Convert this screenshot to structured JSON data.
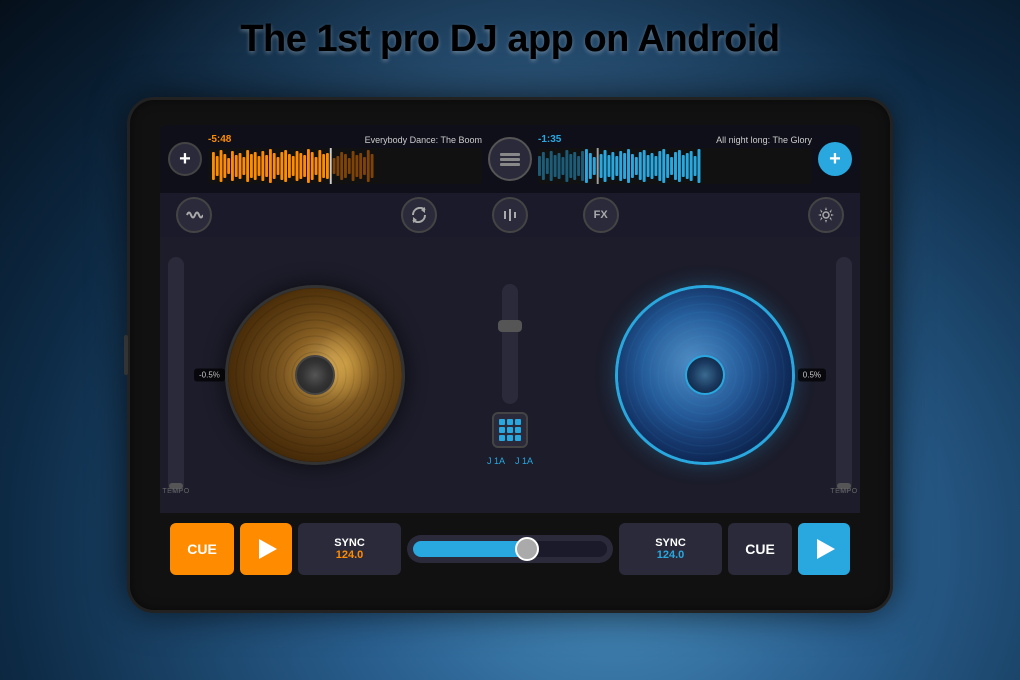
{
  "page": {
    "title": "The 1st pro DJ app on Android"
  },
  "app": {
    "track_left": {
      "time": "-5:48",
      "name": "Everybody Dance: The Boom"
    },
    "track_right": {
      "time": "-1:35",
      "name": "All night long: The Glory"
    },
    "deck_left": {
      "pitch": "-0.5%",
      "sync_label": "SYNC",
      "sync_bpm": "124.0",
      "cue_label": "CUE",
      "tempo_label": "TEMPO"
    },
    "deck_right": {
      "pitch": "0.5%",
      "sync_label": "SYNC",
      "sync_bpm": "124.0",
      "cue_label": "CUE",
      "tempo_label": "TEMPO"
    },
    "center": {
      "label_left": "J 1A",
      "label_right": "J 1A"
    },
    "controls": {
      "fx_label": "FX",
      "add_label": "+"
    }
  }
}
